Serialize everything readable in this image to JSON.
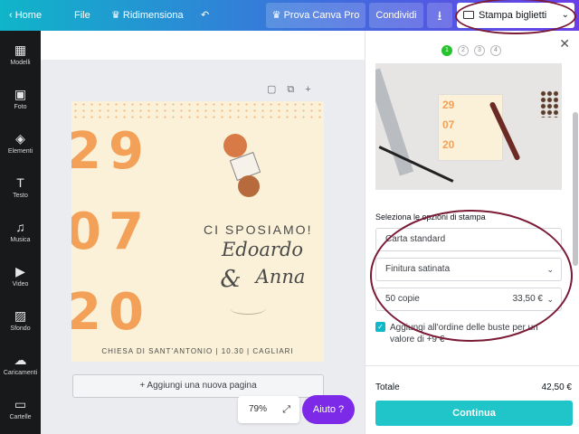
{
  "topbar": {
    "home": "Home",
    "file": "File",
    "resize": "Ridimensiona",
    "pro": "Prova Canva Pro",
    "share": "Condividi",
    "print": "Stampa biglietti"
  },
  "sidebar": {
    "items": [
      {
        "label": "Modelli"
      },
      {
        "label": "Foto"
      },
      {
        "label": "Elementi"
      },
      {
        "label": "Testo"
      },
      {
        "label": "Musica"
      },
      {
        "label": "Video"
      },
      {
        "label": "Sfondo"
      },
      {
        "label": "Caricamenti"
      },
      {
        "label": "Cartelle"
      }
    ]
  },
  "card": {
    "line1": "29",
    "line2": "07",
    "line3": "20",
    "headline": "CI SPOSIAMO!",
    "name1": "Edoardo",
    "ampersand": "&",
    "name2": "Anna",
    "footer": "CHIESA DI SANT'ANTONIO | 10.30 | CAGLIARI"
  },
  "canvas": {
    "add_page": "+ Aggiungi una nuova pagina",
    "zoom": "79%",
    "help": "Aiuto ?"
  },
  "panel": {
    "steps": [
      "1",
      "2",
      "3",
      "4"
    ],
    "preview_card": [
      "29",
      "07",
      "20"
    ],
    "section_label": "Seleziona le opzioni di stampa",
    "paper": "Carta standard",
    "finish": "Finitura satinata",
    "copies": "50 copie",
    "copies_price": "33,50 €",
    "envelopes": "Aggiungi all'ordine delle buste per un valore di +9 €",
    "total_label": "Totale",
    "total_value": "42,50 €",
    "continue": "Continua"
  },
  "colors": {
    "accent_teal": "#1fc5c9",
    "help_purple": "#7d2ae8",
    "card_bg": "#fbf1d9",
    "date_orange": "#f3a159",
    "annotation_ring": "#7a1a35"
  }
}
